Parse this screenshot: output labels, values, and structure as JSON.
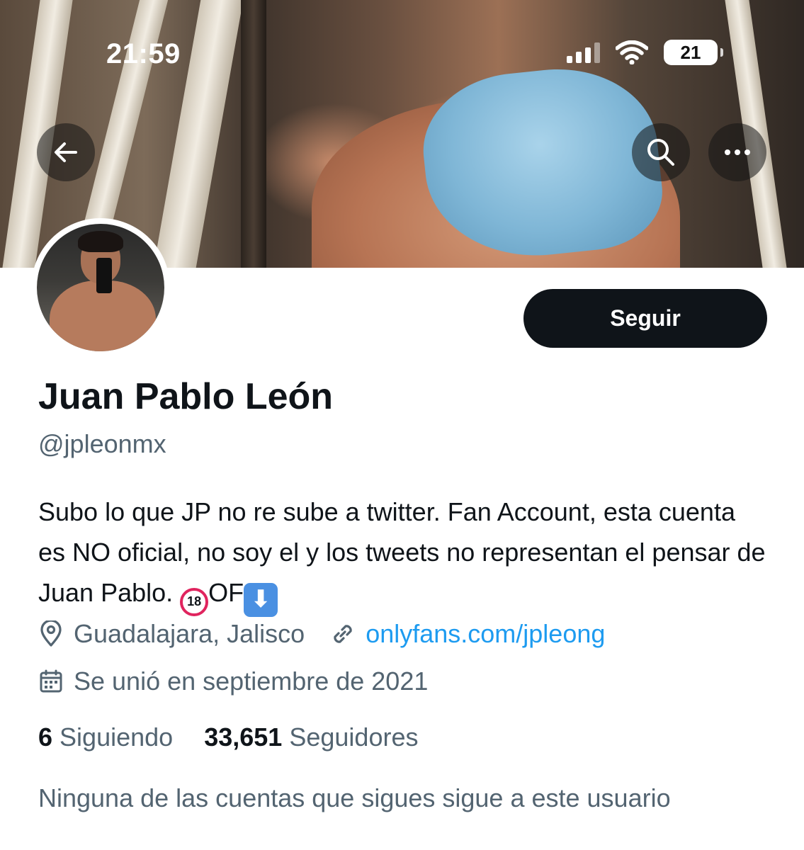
{
  "status_bar": {
    "time": "21:59",
    "battery": "21"
  },
  "header": {
    "back_icon": "arrow-left-icon",
    "search_icon": "search-icon",
    "more_icon": "more-horizontal-icon"
  },
  "profile": {
    "name": "Juan Pablo León",
    "handle": "@jpleonmx",
    "follow_label": "Seguir",
    "bio_text": "Subo lo que JP no re sube a twitter. Fan Account, esta cuenta es NO oficial, no soy el y los tweets no representan el pensar de Juan Pablo.",
    "bio_emoji_18": "18",
    "bio_of": "OF",
    "bio_arrow": "⬇",
    "location": "Guadalajara, Jalisco",
    "link": "onlyfans.com/jpleong",
    "joined": "Se unió en septiembre de 2021",
    "following_count": "6",
    "following_label": "Siguiendo",
    "followers_count": "33,651",
    "followers_label": "Seguidores",
    "followed_by_note": "Ninguna de las cuentas que sigues sigue a este usuario"
  },
  "colors": {
    "text_primary": "#0f1419",
    "text_secondary": "#536471",
    "link": "#1d9bf0",
    "follow_button_bg": "#0f1419"
  }
}
